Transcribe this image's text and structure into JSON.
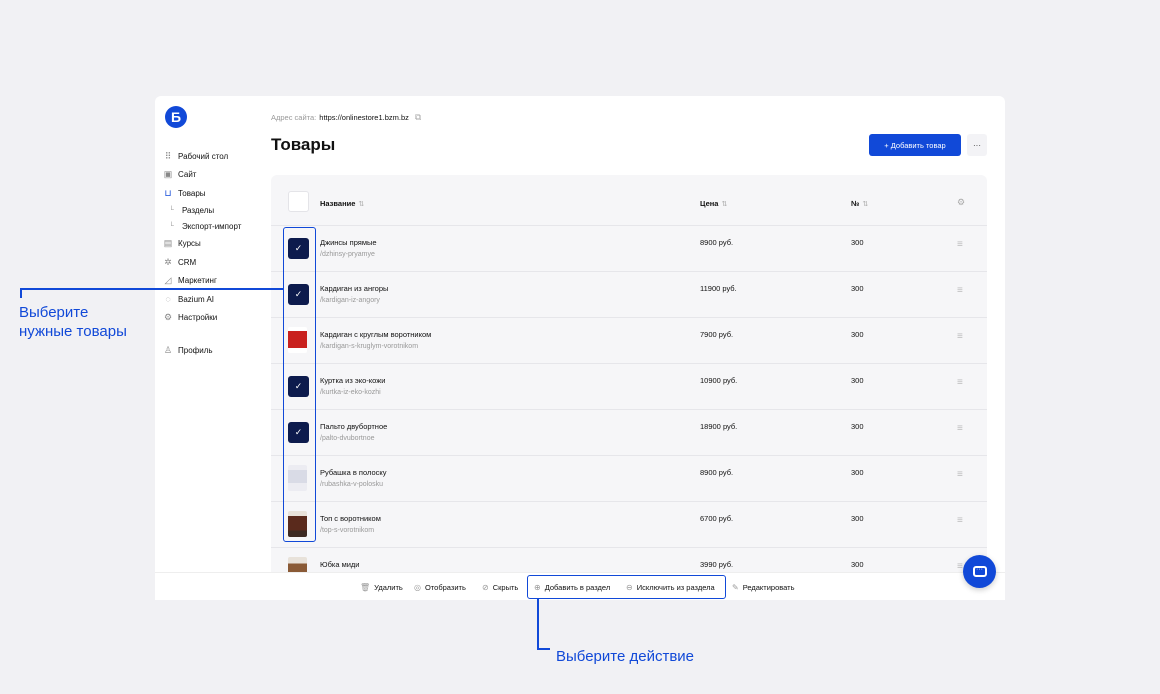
{
  "logo": {
    "letter": "Б"
  },
  "sidebar": {
    "items": [
      {
        "label": "Рабочий стол",
        "icon": "grid-icon"
      },
      {
        "label": "Сайт",
        "icon": "layout-icon"
      },
      {
        "label": "Товары",
        "icon": "bag-icon"
      }
    ],
    "sub": [
      "Разделы",
      "Экспорт-импорт"
    ],
    "items2": [
      {
        "label": "Курсы",
        "icon": "book-icon"
      },
      {
        "label": "CRM",
        "icon": "crm-icon"
      },
      {
        "label": "Маркетинг",
        "icon": "chart-icon"
      },
      {
        "label": "Bazium AI",
        "icon": "ai-icon"
      },
      {
        "label": "Настройки",
        "icon": "gear-icon"
      }
    ],
    "profile": "Профиль"
  },
  "header": {
    "site_label": "Адрес сайта:",
    "site_url": "https://onlinestore1.bzm.bz",
    "title": "Товары",
    "add_button": "+ Добавить товар",
    "more_button": "···"
  },
  "table": {
    "columns": {
      "name": "Название",
      "price": "Цена",
      "num": "№"
    },
    "rows": [
      {
        "name": "Джинсы прямые",
        "slug": "/dzhinsy-pryamye",
        "price": "8900 руб.",
        "num": "300",
        "checked": true
      },
      {
        "name": "Кардиган из ангоры",
        "slug": "/kardigan-iz-angory",
        "price": "11900 руб.",
        "num": "300",
        "checked": true
      },
      {
        "name": "Кардиган с круглым воротником",
        "slug": "/kardigan-s-kruglym-vorotnikom",
        "price": "7900 руб.",
        "num": "300",
        "checked": false
      },
      {
        "name": "Куртка из эко-кожи",
        "slug": "/kurtka-iz-eko-kozhi",
        "price": "10900 руб.",
        "num": "300",
        "checked": true
      },
      {
        "name": "Пальто двубортное",
        "slug": "/palto-dvubortnoe",
        "price": "18900 руб.",
        "num": "300",
        "checked": true
      },
      {
        "name": "Рубашка в полоску",
        "slug": "/rubashka-v-polosku",
        "price": "8900 руб.",
        "num": "300",
        "checked": false
      },
      {
        "name": "Топ с воротником",
        "slug": "/top-s-vorotnikom",
        "price": "6700 руб.",
        "num": "300",
        "checked": false
      },
      {
        "name": "Юбка миди",
        "slug": "",
        "price": "3990 руб.",
        "num": "300",
        "checked": false
      }
    ]
  },
  "actions": {
    "delete": "Удалить",
    "show": "Отобразить",
    "hide": "Скрыть",
    "add_to_section": "Добавить в раздел",
    "remove_from_section": "Исключить из раздела",
    "edit": "Редактировать"
  },
  "annotations": {
    "select_line1": "Выберите",
    "select_line2": "нужные товары",
    "action": "Выберите действие"
  },
  "colors": {
    "accent": "#1149d8",
    "checkbox": "#0d1b4d"
  }
}
